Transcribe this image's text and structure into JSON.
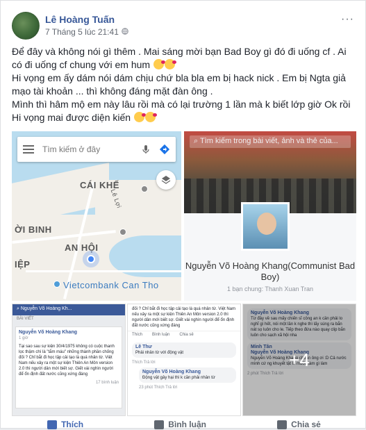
{
  "post": {
    "author": "Lê Hoàng Tuấn",
    "time": "7 Tháng 5 lúc 21:41",
    "more": "···",
    "lines": [
      "Để đây và không nói gì thêm . Mai sáng mời bạn Bad Boy gì đó đi uống cf . Ai có đi uống cf chung với em hum",
      "Hi vọng em ấy dám nói dám chịu chứ bla bla em bị hack nick . Em bị Ngta giả mạo tài khoản ... thì không đáng mặt đàn ông .",
      "Mình thì hâm mộ em này lâu rồi mà có lại trường 1 lần mà k biết lớp giờ Ok rồi Hi vọng mai được diện kiến"
    ]
  },
  "map": {
    "search_placeholder": "Tìm kiếm ở đây",
    "labels": {
      "cai_khe": "CÁI KHẾ",
      "ninh_kieu": "ỜI BINH",
      "an_hoi": "AN HỘI",
      "hiep": "IỆP",
      "vcb": "Vietcombank Can Tho",
      "street": "Lê Lợi"
    }
  },
  "profile": {
    "search_text": "Tìm kiếm trong bài viết, ảnh và thẻ của...",
    "name": "Nguyễn Võ Hoàng Khang(Communist Bad Boy)",
    "friend": "1 bạn chung: Thanh Xuan Tran"
  },
  "shot1": {
    "top": "Nguyễn Võ Hoàng Kh...",
    "sub": "BÀI VIẾT",
    "name": "Nguyễn Võ Hoàng Khang",
    "time": "1 giờ",
    "body": "Tại sao sau sự kiện 30/4/1975 không có cuộc thanh lọc thậm chí là \"tắm máu\" những thành phần chống đối ? Chỉ bắt đi học tập cải tạo là quá nhân từ. Việt Nam nếu xảy ra một sự kiện Thiên An Môn version 2.0 thì người dân mới biết sợ. Giết vài nghìn người để ổn định đất nước cũng xứng đáng",
    "footer": "17 bình luận"
  },
  "shot2": {
    "top": "đối ? Chỉ bắt đi học tập cải tạo là quá nhân từ. Việt Nam nếu xảy ra một sự kiện Thiên An Môn version 2.0 thì người dân mới biết sợ. Giết vài nghìn người để ổn định đất nước cũng xứng đáng",
    "actions": [
      "Thích",
      "Bình luận",
      "Chia sẻ"
    ],
    "c1_name": "Lê Thư",
    "c1_text": "Phải nhân từ với động vật",
    "c1_meta": "Thích   Trả lời",
    "c2_name": "Nguyễn Võ Hoàng Khang",
    "c2_text": "Động vật gây hại thì k cần phải nhân từ",
    "c2_meta": "23 phút   Thích   Trả lời"
  },
  "shot3": {
    "name1": "Nguyễn Võ Hoàng Khang",
    "text1": "Từ đây về sau mấy chiến sĩ công an k cần phải lo nghĩ gì hết, nói một lần k nghe thì lấy súng ra bắn nát sọ luôn cho le. Tiếp theo đứa nào quay clip bắn luôn cho sạch xã hội nha",
    "name2": "Minh Tân",
    "name3": "Nguyễn Võ Hoàng Khang",
    "text3": "Nguyễn Võ Hoàng Khang chuẩn ông ơi :D Cả nước mình cứ ng khuyết tật là muốn làm gì làm",
    "meta": "2 phút   Thích   Trả lời",
    "overlay": "+4"
  },
  "actions": {
    "like": "Thích",
    "comment": "Bình luận",
    "share": "Chia sẻ"
  }
}
